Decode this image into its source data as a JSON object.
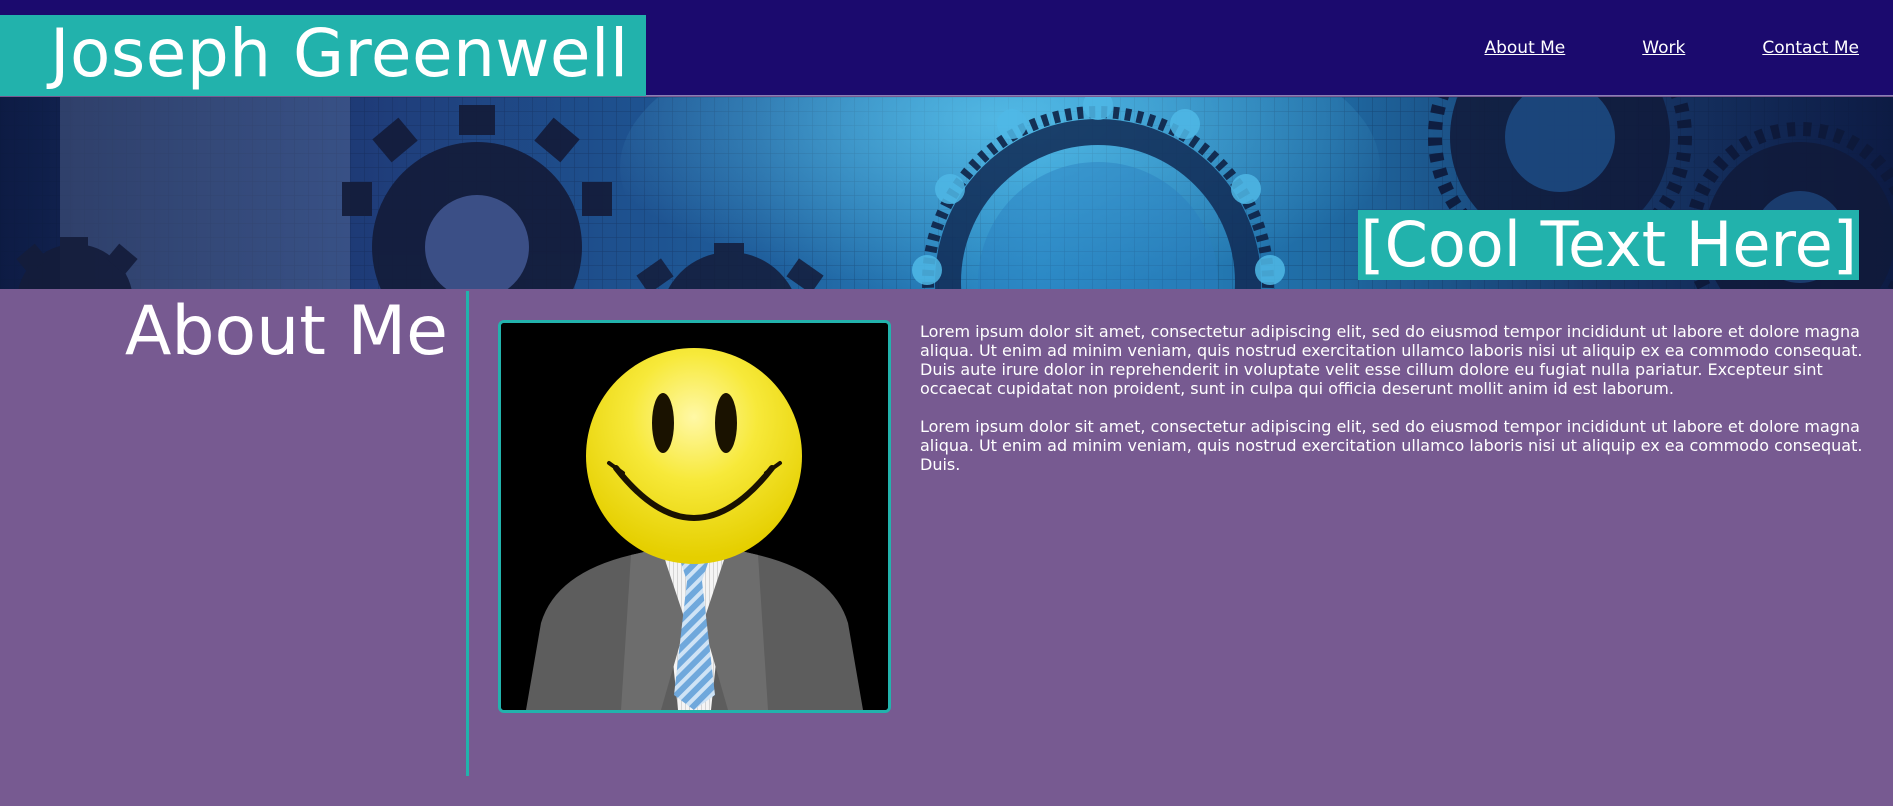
{
  "header": {
    "brand_name": "Joseph Greenwell",
    "nav": [
      {
        "label": "About Me"
      },
      {
        "label": "Work"
      },
      {
        "label": "Contact Me"
      }
    ]
  },
  "banner": {
    "tagline": "[Cool Text Here]"
  },
  "about": {
    "heading": "About Me",
    "paragraphs": [
      "Lorem ipsum dolor sit amet, consectetur adipiscing elit, sed do eiusmod tempor incididunt ut labore et dolore magna aliqua. Ut enim ad minim veniam, quis nostrud exercitation ullamco laboris nisi ut aliquip ex ea commodo consequat. Duis aute irure dolor in reprehenderit in voluptate velit esse cillum dolore eu fugiat nulla pariatur. Excepteur sint occaecat cupidatat non proident, sunt in culpa qui officia deserunt mollit anim id est laborum.",
      "Lorem ipsum dolor sit amet, consectetur adipiscing elit, sed do eiusmod tempor incididunt ut labore et dolore magna aliqua. Ut enim ad minim veniam, quis nostrud exercitation ullamco laboris nisi ut aliquip ex ea commodo consequat. Duis."
    ]
  },
  "colors": {
    "header_bg": "#1b0a6e",
    "accent": "#22b2ac",
    "page_bg": "#775a91",
    "text": "#ffffff"
  }
}
